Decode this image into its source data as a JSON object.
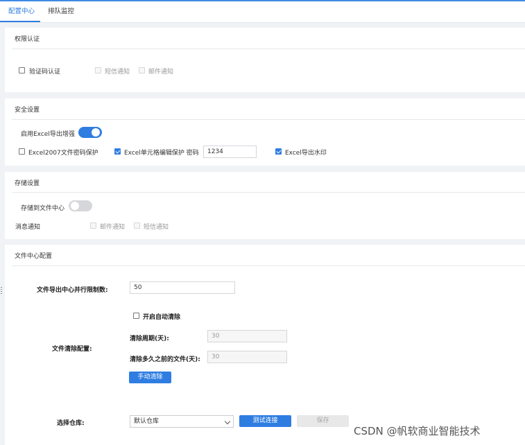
{
  "tabs": [
    {
      "label": "配置中心",
      "active": true
    },
    {
      "label": "排队监控",
      "active": false
    }
  ],
  "auth": {
    "title": "权限认证",
    "captcha": {
      "label": "验证码认证",
      "checked": false
    },
    "sms": {
      "label": "短信通知",
      "checked": false,
      "disabled": true
    },
    "email": {
      "label": "邮件通知",
      "checked": false,
      "disabled": true
    }
  },
  "security": {
    "title": "安全设置",
    "enhance_label": "启用Excel导出增强",
    "enhance_on": true,
    "excel2007": {
      "label": "Excel2007文件密码保护",
      "checked": false
    },
    "cell_protect": {
      "label": "Excel单元格编辑保护 密码",
      "checked": true
    },
    "password_value": "1234",
    "watermark": {
      "label": "Excel导出水印",
      "checked": true
    }
  },
  "storage": {
    "title": "存储设置",
    "store_label": "存储到文件中心",
    "store_on": false,
    "notify_label": "消息通知",
    "email": {
      "label": "邮件通知",
      "checked": false,
      "disabled": true
    },
    "sms": {
      "label": "短信通知",
      "checked": false,
      "disabled": true
    }
  },
  "file_center": {
    "title": "文件中心配置",
    "concurrency_label": "文件导出中心并行限制数:",
    "concurrency_value": "50",
    "auto_clean": {
      "label": "开启自动清除",
      "checked": false
    },
    "clean_config_label": "文件清除配置:",
    "period_label": "清除周期(天):",
    "period_value": "30",
    "age_label": "清除多久之前的文件(天):",
    "age_value": "30",
    "manual_clean_label": "手动清除",
    "repo_label": "选择仓库:",
    "repo_value": "默认仓库",
    "test_label": "测试连接",
    "save_label": "保存"
  },
  "colors": {
    "accent": "#2f7de1",
    "background": "#f0f2f5"
  },
  "watermark_text": "CSDN @帆软商业智能技术"
}
